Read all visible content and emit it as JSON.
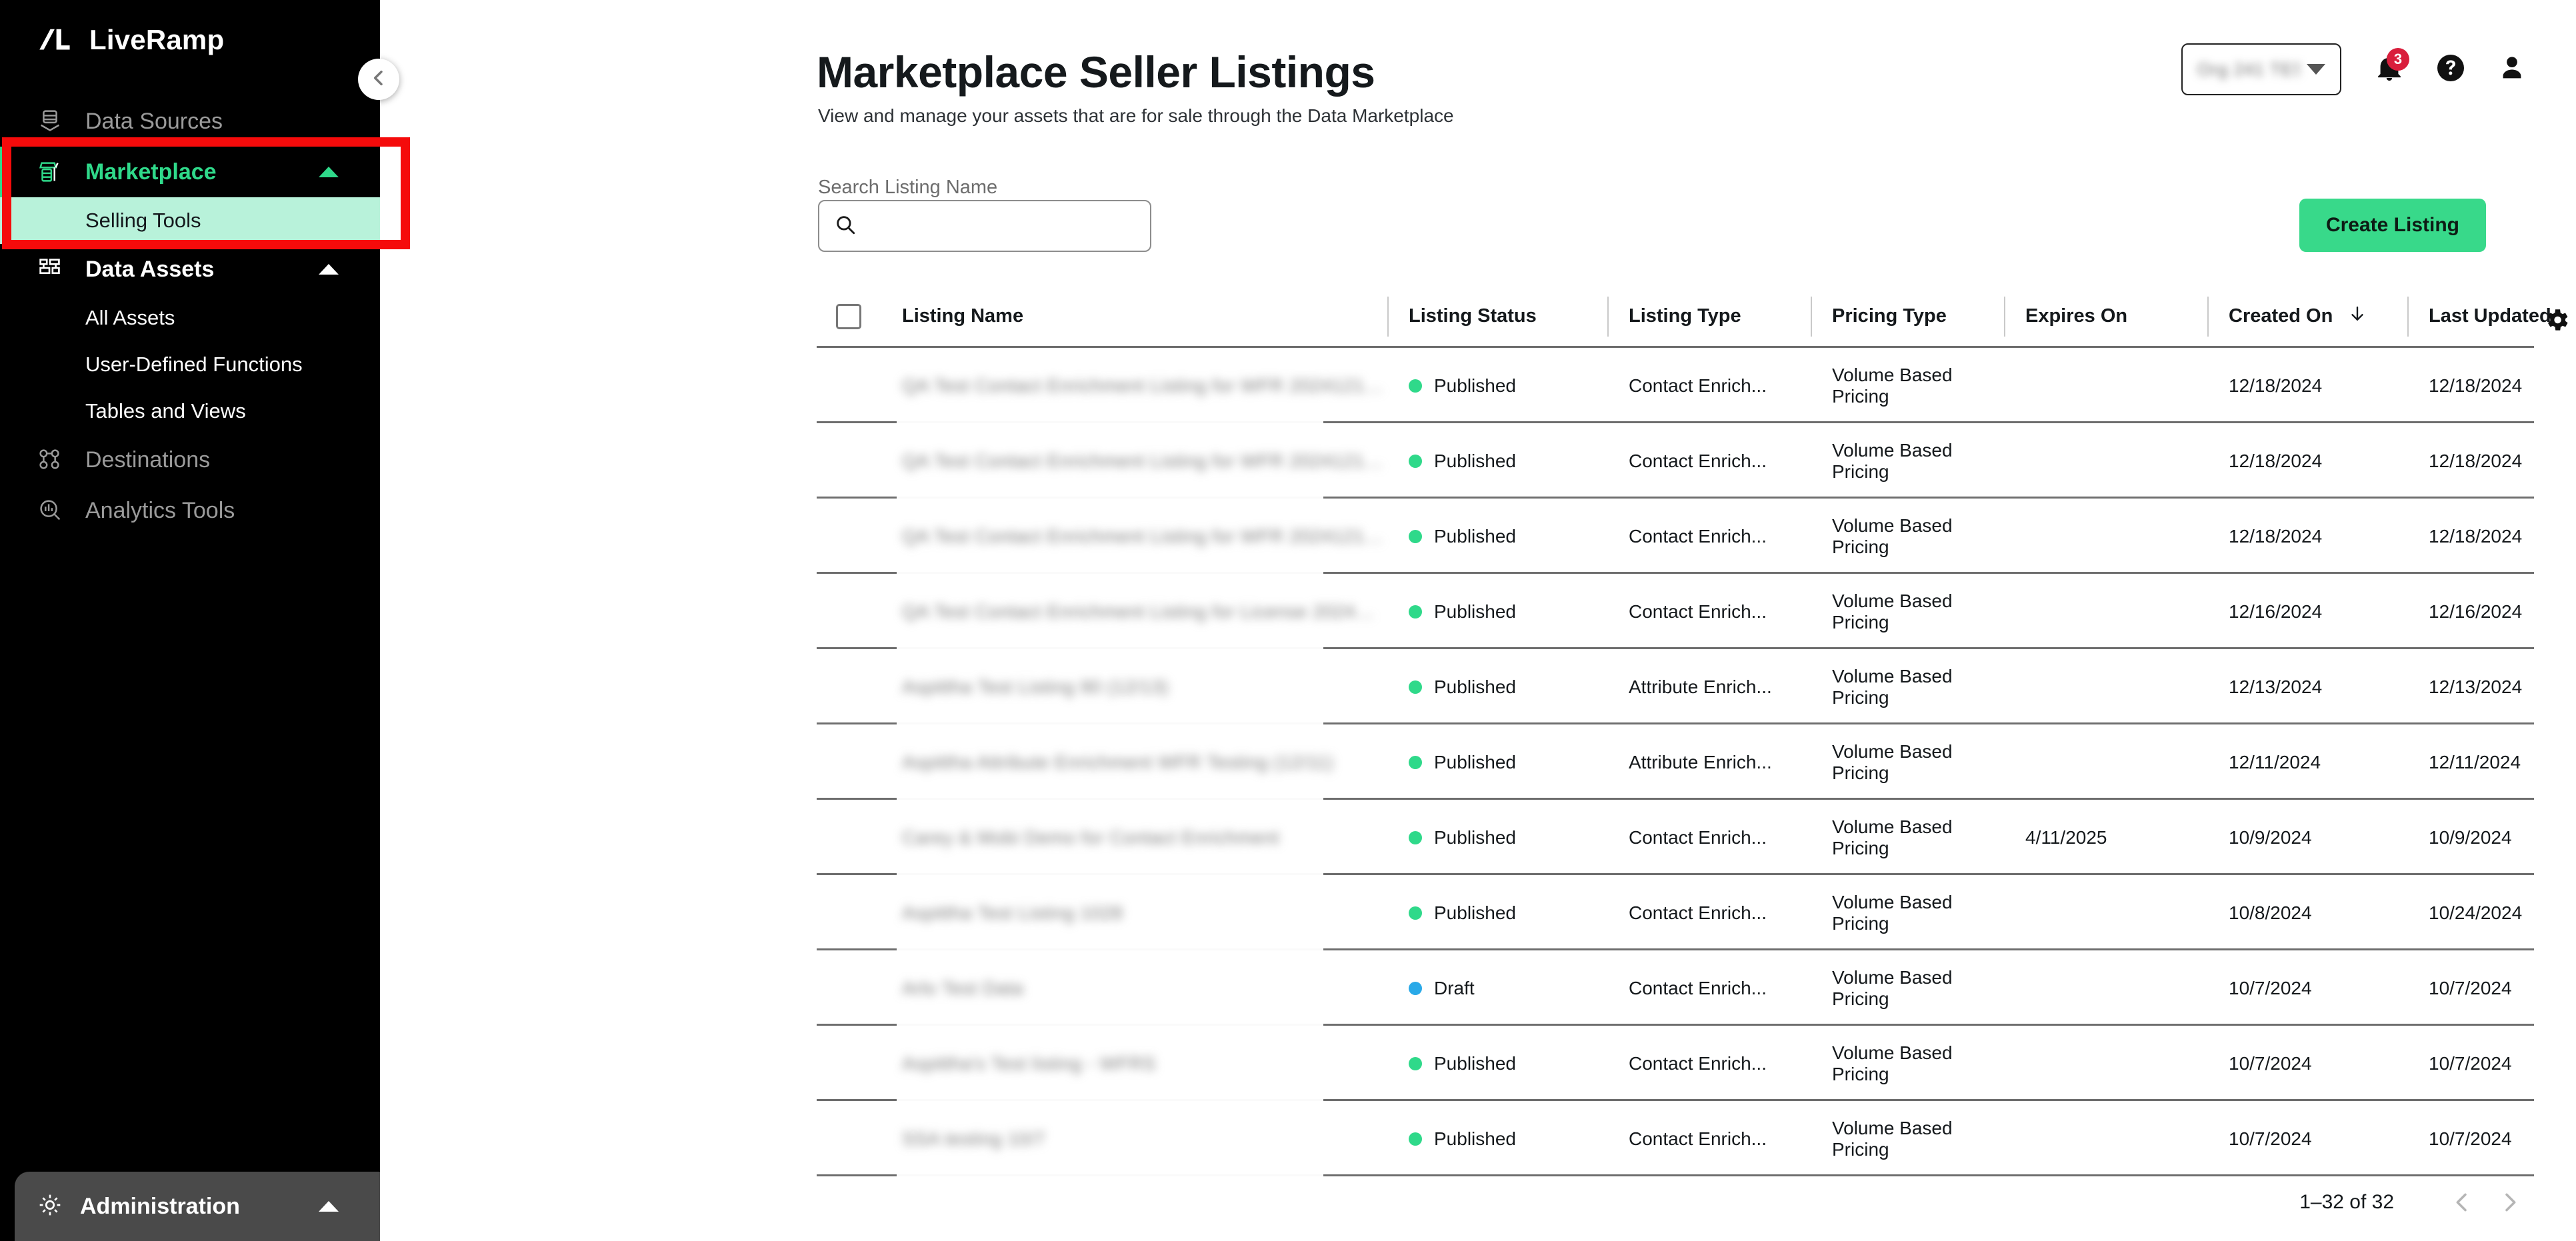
{
  "brand": {
    "name": "LiveRamp",
    "logo_icon": "liveramp-logo"
  },
  "sidebar": {
    "collapse_icon": "chevron-left-icon",
    "items": [
      {
        "label": "Data Sources",
        "icon": "data-sources-icon",
        "state": "dim",
        "expandable": false
      },
      {
        "label": "Marketplace",
        "icon": "marketplace-storefront-icon",
        "state": "active",
        "expandable": true,
        "expanded": true
      },
      {
        "label": "Data Assets",
        "icon": "data-assets-icon",
        "state": "white",
        "expandable": true,
        "expanded": true
      },
      {
        "label": "Destinations",
        "icon": "destinations-icon",
        "state": "dim",
        "expandable": false
      },
      {
        "label": "Analytics Tools",
        "icon": "analytics-tools-icon",
        "state": "dim",
        "expandable": false
      }
    ],
    "marketplace_children": [
      {
        "label": "Selling Tools",
        "selected": true
      }
    ],
    "data_assets_children": [
      {
        "label": "All Assets",
        "selected": false
      },
      {
        "label": "User-Defined Functions",
        "selected": false
      },
      {
        "label": "Tables and Views",
        "selected": false
      }
    ],
    "administration": {
      "label": "Administration",
      "icon": "gear-icon",
      "expanded": true
    }
  },
  "topbar": {
    "account_select": {
      "value": "",
      "redacted": true,
      "caret_icon": "chevron-down-icon"
    },
    "notifications": {
      "icon": "bell-icon",
      "badge": "3",
      "badge_color": "#D91E3C"
    },
    "help": {
      "icon": "help-circle-icon"
    },
    "profile": {
      "icon": "user-avatar-icon"
    }
  },
  "header": {
    "title": "Marketplace Seller Listings",
    "subtitle": "View and manage your assets that are for sale through the Data Marketplace"
  },
  "search": {
    "label": "Search Listing Name",
    "value": "",
    "placeholder": "",
    "icon": "search-icon"
  },
  "actions": {
    "create_listing": "Create Listing",
    "create_listing_color": "#38D98A"
  },
  "table": {
    "select_all_checkbox": false,
    "settings_icon": "gear-icon",
    "sort": {
      "column": "Created On",
      "direction": "desc",
      "icon": "arrow-down-icon"
    },
    "columns": [
      "Listing Name",
      "Listing Status",
      "Listing Type",
      "Pricing Type",
      "Expires On",
      "Created On",
      "Last Updated"
    ],
    "rows": [
      {
        "name": "",
        "name_redacted": true,
        "status": "Published",
        "status_color": "#2FD98A",
        "type": "Contact Enrich...",
        "pricing": "Volume Based Pricing",
        "expires": "",
        "created": "12/18/2024",
        "updated": "12/18/2024"
      },
      {
        "name": "",
        "name_redacted": true,
        "status": "Published",
        "status_color": "#2FD98A",
        "type": "Contact Enrich...",
        "pricing": "Volume Based Pricing",
        "expires": "",
        "created": "12/18/2024",
        "updated": "12/18/2024"
      },
      {
        "name": "",
        "name_redacted": true,
        "status": "Published",
        "status_color": "#2FD98A",
        "type": "Contact Enrich...",
        "pricing": "Volume Based Pricing",
        "expires": "",
        "created": "12/18/2024",
        "updated": "12/18/2024"
      },
      {
        "name": "",
        "name_redacted": true,
        "status": "Published",
        "status_color": "#2FD98A",
        "type": "Contact Enrich...",
        "pricing": "Volume Based Pricing",
        "expires": "",
        "created": "12/16/2024",
        "updated": "12/16/2024"
      },
      {
        "name": "",
        "name_redacted": true,
        "status": "Published",
        "status_color": "#2FD98A",
        "type": "Attribute Enrich...",
        "pricing": "Volume Based Pricing",
        "expires": "",
        "created": "12/13/2024",
        "updated": "12/13/2024"
      },
      {
        "name": "",
        "name_redacted": true,
        "status": "Published",
        "status_color": "#2FD98A",
        "type": "Attribute Enrich...",
        "pricing": "Volume Based Pricing",
        "expires": "",
        "created": "12/11/2024",
        "updated": "12/11/2024"
      },
      {
        "name": "",
        "name_redacted": true,
        "status": "Published",
        "status_color": "#2FD98A",
        "type": "Contact Enrich...",
        "pricing": "Volume Based Pricing",
        "expires": "4/11/2025",
        "created": "10/9/2024",
        "updated": "10/9/2024"
      },
      {
        "name": "",
        "name_redacted": true,
        "status": "Published",
        "status_color": "#2FD98A",
        "type": "Contact Enrich...",
        "pricing": "Volume Based Pricing",
        "expires": "",
        "created": "10/8/2024",
        "updated": "10/24/2024"
      },
      {
        "name": "",
        "name_redacted": true,
        "status": "Draft",
        "status_color": "#29A9E8",
        "type": "Contact Enrich...",
        "pricing": "Volume Based Pricing",
        "expires": "",
        "created": "10/7/2024",
        "updated": "10/7/2024"
      },
      {
        "name": "",
        "name_redacted": true,
        "status": "Published",
        "status_color": "#2FD98A",
        "type": "Contact Enrich...",
        "pricing": "Volume Based Pricing",
        "expires": "",
        "created": "10/7/2024",
        "updated": "10/7/2024"
      },
      {
        "name": "",
        "name_redacted": true,
        "status": "Published",
        "status_color": "#2FD98A",
        "type": "Contact Enrich...",
        "pricing": "Volume Based Pricing",
        "expires": "",
        "created": "10/7/2024",
        "updated": "10/7/2024"
      }
    ]
  },
  "pagination": {
    "range_text": "1–32 of 32",
    "prev_icon": "chevron-left-icon",
    "next_icon": "chevron-right-icon"
  },
  "annotation": {
    "type": "highlight-rectangle",
    "color": "#F50B0B"
  }
}
